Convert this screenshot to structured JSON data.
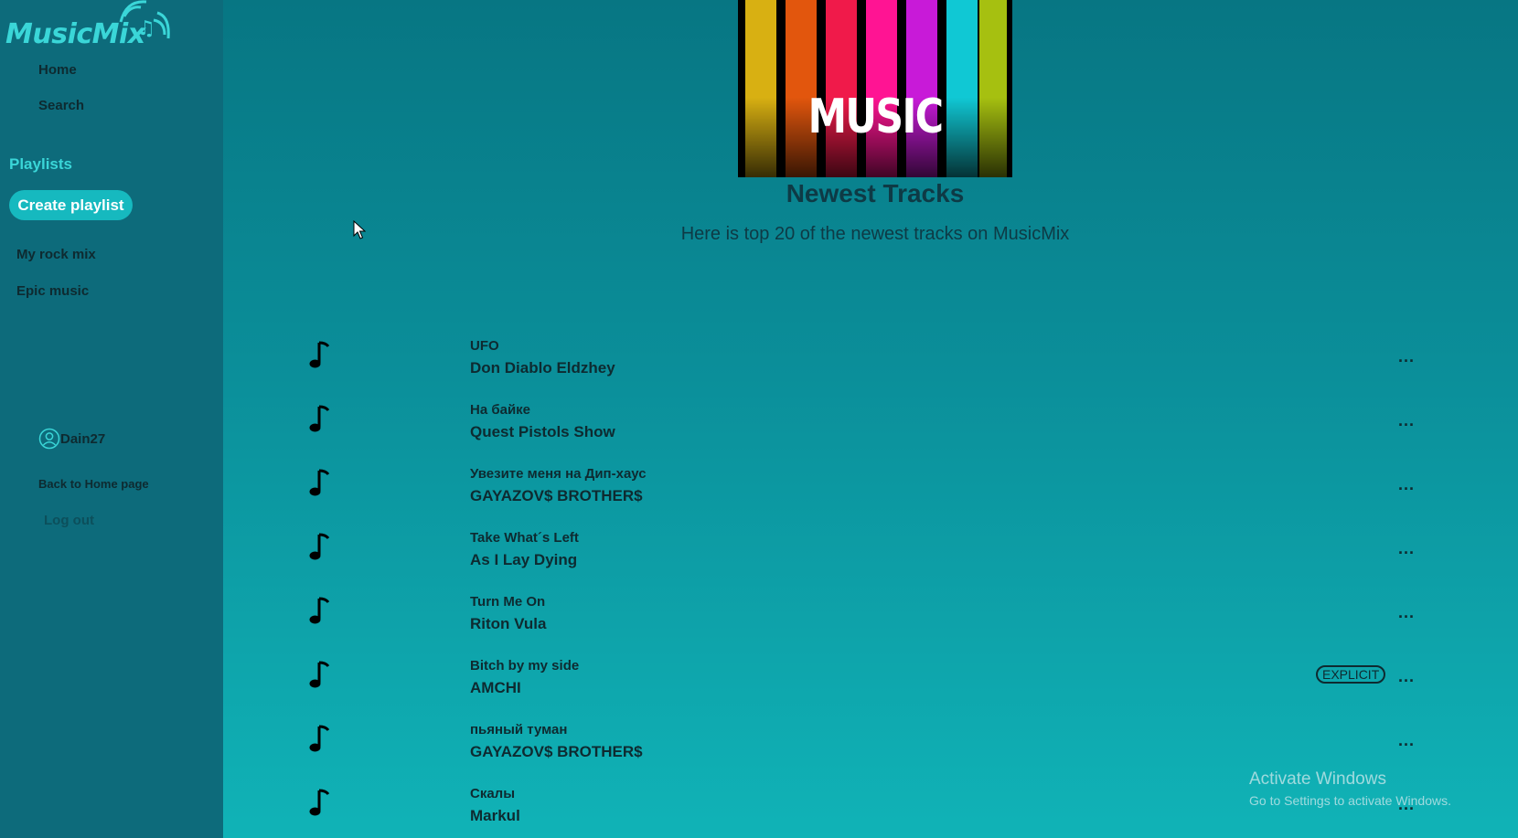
{
  "app": {
    "logo_text": "MusicMix"
  },
  "sidebar": {
    "nav": [
      {
        "label": "Home"
      },
      {
        "label": "Search"
      }
    ],
    "playlists_heading": "Playlists",
    "create_playlist_label": "Create playlist",
    "playlists": [
      {
        "label": "My rock mix"
      },
      {
        "label": "Epic music"
      }
    ],
    "user": {
      "name": "Dain27",
      "icon": "user-avatar-icon"
    },
    "back_link": "Back to Home page",
    "logout": "Log out"
  },
  "main": {
    "cover_text": "MUSIC",
    "title": "Newest Tracks",
    "subtitle": "Here is top 20 of the newest tracks on MusicMix",
    "more_label": "...",
    "explicit_label": "EXPLICIT",
    "tracks": [
      {
        "name": "UFO",
        "artist": "Don Diablo  Eldzhey",
        "explicit": false
      },
      {
        "name": "На байке",
        "artist": "Quest Pistols Show",
        "explicit": false
      },
      {
        "name": "Увезите меня на Дип-хаус",
        "artist": "GAYAZOV$ BROTHER$",
        "explicit": false
      },
      {
        "name": "Take What´s Left",
        "artist": "As I Lay Dying",
        "explicit": false
      },
      {
        "name": "Turn Me On",
        "artist": "Riton  Vula",
        "explicit": false
      },
      {
        "name": "Bitch by my side",
        "artist": "AMCHI",
        "explicit": true
      },
      {
        "name": "пьяный туман",
        "artist": "GAYAZOV$ BROTHER$",
        "explicit": false
      },
      {
        "name": "Скалы",
        "artist": "Markul",
        "explicit": false
      }
    ]
  },
  "watermark": {
    "line1": "Activate Windows",
    "line2": "Go to Settings to activate Windows."
  },
  "colors": {
    "sidebar_bg": "#0d6b7b",
    "accent": "#3ad6d8",
    "button_bg": "#16b9bf",
    "text_dark": "#0e2a30"
  }
}
